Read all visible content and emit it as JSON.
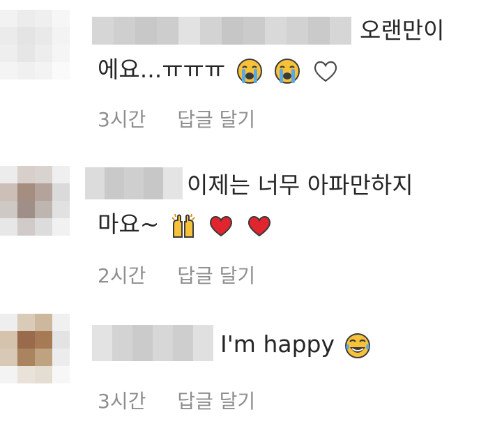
{
  "comments": [
    {
      "text_line1": "오랜만이",
      "text_line2": "에요...ㅠㅠㅠ",
      "time": "3시간",
      "reply_label": "답글 달기",
      "emojis": [
        "loudly-crying-face-icon",
        "loudly-crying-face-icon",
        "white-heart-icon"
      ]
    },
    {
      "text_line1": "이제는 너무 아파만하지",
      "text_line2": "마요~",
      "time": "2시간",
      "reply_label": "답글 달기",
      "emojis": [
        "raising-hands-icon",
        "red-heart-icon",
        "red-heart-icon"
      ]
    },
    {
      "text_line1": "I'm happy",
      "time": "3시간",
      "reply_label": "답글 달기",
      "emojis": [
        "tears-of-joy-face-icon"
      ]
    }
  ],
  "colors": {
    "text": "#262626",
    "meta": "#8e8e8e",
    "emoji_yellow": "#f7c23a",
    "heart_red": "#e0252f"
  }
}
